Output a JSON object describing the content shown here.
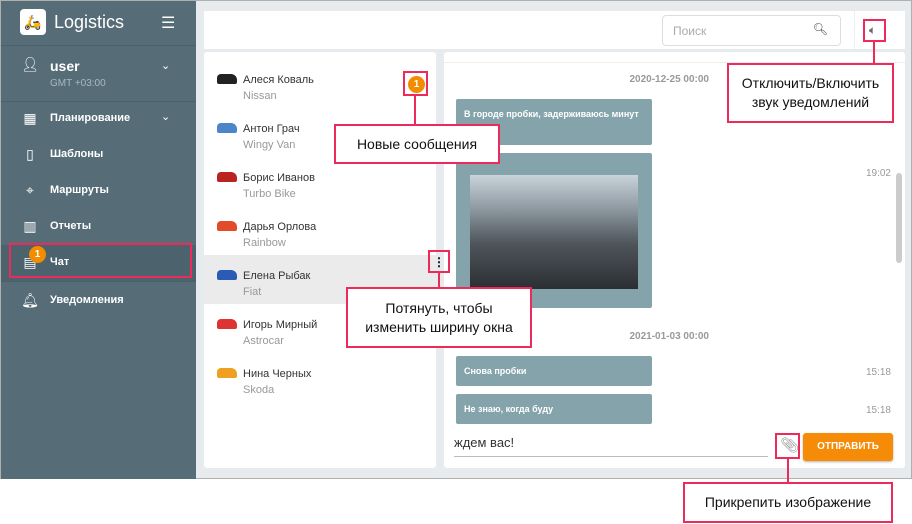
{
  "sidebar": {
    "brand": "Logistics",
    "user": "user",
    "timezone": "GMT +03:00",
    "items": [
      {
        "label": "Планирование"
      },
      {
        "label": "Шаблоны"
      },
      {
        "label": "Маршруты"
      },
      {
        "label": "Отчеты"
      },
      {
        "label": "Чат",
        "badge": "1"
      },
      {
        "label": "Уведомления"
      }
    ]
  },
  "topbar": {
    "search_placeholder": "Поиск"
  },
  "contacts": [
    {
      "name": "Алеся Коваль",
      "vehicle": "Nissan",
      "color": "#222",
      "badge": "1"
    },
    {
      "name": "Антон Грач",
      "vehicle": "Wingy Van",
      "color": "#4a86c8"
    },
    {
      "name": "Борис Иванов",
      "vehicle": "Turbo Bike",
      "color": "#b22"
    },
    {
      "name": "Дарья Орлова",
      "vehicle": "Rainbow",
      "color": "#e24a2a"
    },
    {
      "name": "Елена Рыбак",
      "vehicle": "Fiat",
      "color": "#2a5bb5"
    },
    {
      "name": "Игорь Мирный",
      "vehicle": "Astrocar",
      "color": "#d33"
    },
    {
      "name": "Нина Черных",
      "vehicle": "Skoda",
      "color": "#f0a020"
    }
  ],
  "chat": {
    "date1": "2020-12-25 00:00",
    "msg1": "В городе пробки, задерживаюсь минут",
    "img_time": "19:02",
    "date2": "2021-01-03 00:00",
    "msg2": "Снова пробки",
    "msg2_time": "15:18",
    "msg3": "Не знаю, когда буду",
    "msg3_time": "15:18",
    "input_value": "ждем вас!",
    "send_label": "ОТПРАВИТЬ"
  },
  "callouts": {
    "new_messages": "Новые сообщения",
    "resize": "Потянуть, чтобы изменить ширину окна",
    "sound": "Отключить/Включить звук уведомлений",
    "attach": "Прикрепить изображение"
  }
}
